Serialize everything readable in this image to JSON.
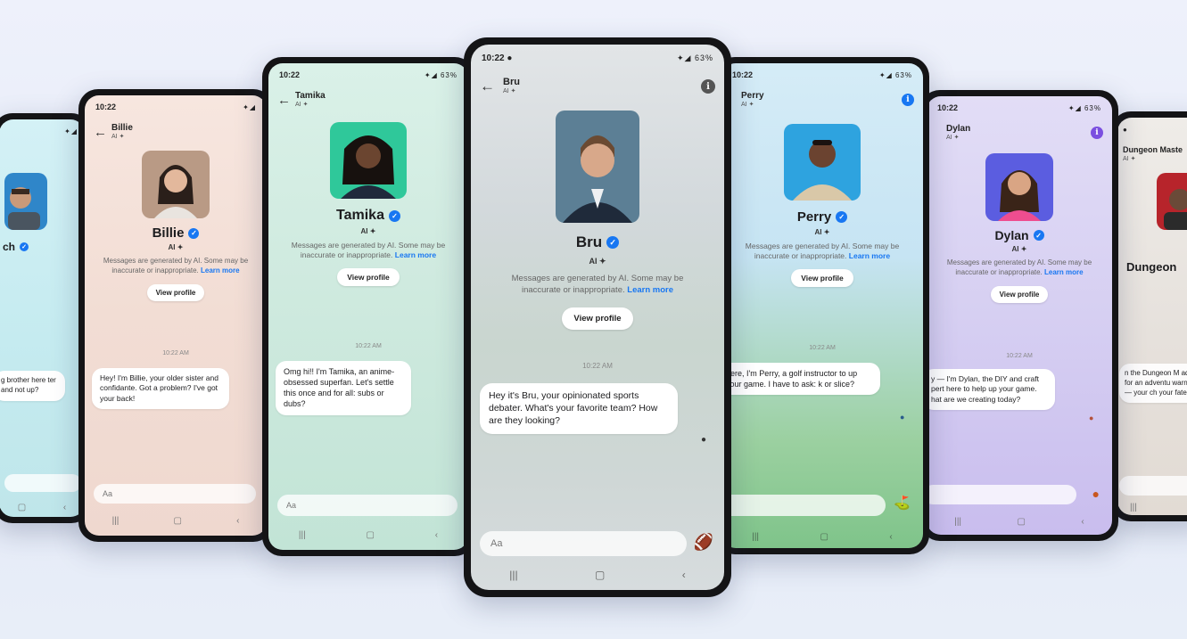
{
  "status": {
    "time": "10:22",
    "battery": "63%"
  },
  "common": {
    "ai_label": "AI",
    "disclaimer": "Messages are generated by AI. Some may be inaccurate or inappropriate.",
    "learn_more": "Learn more",
    "view_profile": "View profile",
    "timestamp": "10:22 AM",
    "composer_placeholder": "Aa"
  },
  "phones": {
    "coach": {
      "name": "ch",
      "message": "g brother here ter and not up?"
    },
    "billie": {
      "name": "Billie",
      "message": "Hey! I'm Billie, your older sister and confidante. Got a problem? I've got your back!"
    },
    "tamika": {
      "name": "Tamika",
      "message": "Omg hi!! I'm Tamika, an anime-obsessed superfan. Let's settle this once and for all: subs or dubs?"
    },
    "bru": {
      "name": "Bru",
      "message": "Hey it's Bru, your opinionated sports debater. What's your favorite team? How are they looking?"
    },
    "perry": {
      "name": "Perry",
      "message": "here, I'm Perry, a golf instructor to up your game. I have to ask: k or slice?"
    },
    "dylan": {
      "name": "Dylan",
      "message": "y — I'm Dylan, the DIY and craft pert here to help up your game. hat are we creating today?"
    },
    "dungeon": {
      "name": "Dungeon Maste",
      "big_name": "Dungeon",
      "message": "n the Dungeon M ady for an adventu warned — your ch your fate."
    }
  },
  "colors": {
    "verified": "#1877f2",
    "coach_bg": "#cfeef2",
    "billie_bg": "#f4e2da",
    "tamika_bg": "#d6eee6",
    "bru_bg": "#d8dde0",
    "perry_bg": "#cfe6f2",
    "dylan_bg": "#ddd8f3",
    "dungeon_bg": "#ece8e4"
  }
}
